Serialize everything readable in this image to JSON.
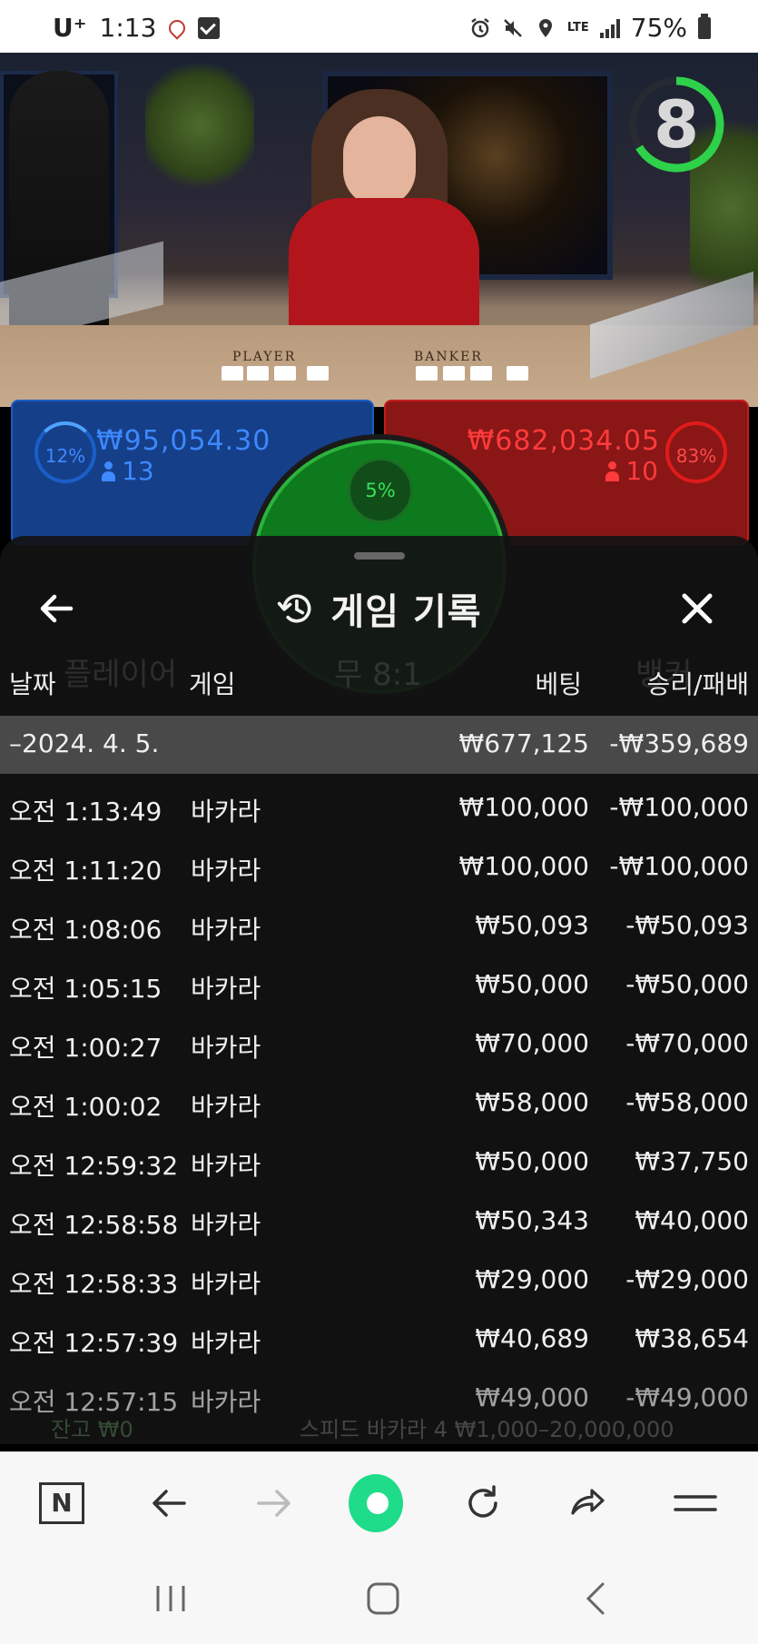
{
  "status_bar": {
    "carrier": "U⁺",
    "time": "1:13",
    "lte": "LTE",
    "battery": "75%"
  },
  "video": {
    "timer": "8",
    "table_label_player": "PLAYER",
    "table_label_banker": "BANKER"
  },
  "bets": {
    "player": {
      "percent": "12%",
      "amount": "₩95,054.30",
      "count": "13"
    },
    "banker": {
      "percent": "83%",
      "amount": "₩682,034.05",
      "count": "10"
    },
    "tie": {
      "percent": "5%"
    }
  },
  "sheet": {
    "title": "게임 기록",
    "columns": {
      "date": "날짜",
      "game": "게임",
      "bet": "베팅",
      "result": "승리/패배"
    },
    "summary": {
      "date": "–2024. 4. 5.",
      "bet": "₩677,125",
      "result": "-₩359,689"
    },
    "rows": [
      {
        "time": "오전 1:13:49",
        "game": "바카라",
        "bet": "₩100,000",
        "result": "-₩100,000"
      },
      {
        "time": "오전 1:11:20",
        "game": "바카라",
        "bet": "₩100,000",
        "result": "-₩100,000"
      },
      {
        "time": "오전 1:08:06",
        "game": "바카라",
        "bet": "₩50,093",
        "result": "-₩50,093"
      },
      {
        "time": "오전 1:05:15",
        "game": "바카라",
        "bet": "₩50,000",
        "result": "-₩50,000"
      },
      {
        "time": "오전 1:00:27",
        "game": "바카라",
        "bet": "₩70,000",
        "result": "-₩70,000"
      },
      {
        "time": "오전 1:00:02",
        "game": "바카라",
        "bet": "₩58,000",
        "result": "-₩58,000"
      },
      {
        "time": "오전 12:59:32",
        "game": "바카라",
        "bet": "₩50,000",
        "result": "₩37,750"
      },
      {
        "time": "오전 12:58:58",
        "game": "바카라",
        "bet": "₩50,343",
        "result": "₩40,000"
      },
      {
        "time": "오전 12:58:33",
        "game": "바카라",
        "bet": "₩29,000",
        "result": "-₩29,000"
      },
      {
        "time": "오전 12:57:39",
        "game": "바카라",
        "bet": "₩40,689",
        "result": "₩38,654"
      },
      {
        "time": "오전 12:57:15",
        "game": "바카라",
        "bet": "₩49,000",
        "result": "-₩49,000"
      }
    ]
  },
  "background_text": {
    "player_label": "플레이어",
    "tie_label": "무 8:1",
    "banker_label": "뱅커",
    "balance": "잔고 ₩0",
    "table_info": "스피드 바카라 4 ₩1,000–20,000,000"
  },
  "colors": {
    "player_blue": "#3d89ff",
    "banker_red": "#ff3b3b",
    "tie_green": "#38e05a",
    "browser_green": "#1fdc8a"
  }
}
